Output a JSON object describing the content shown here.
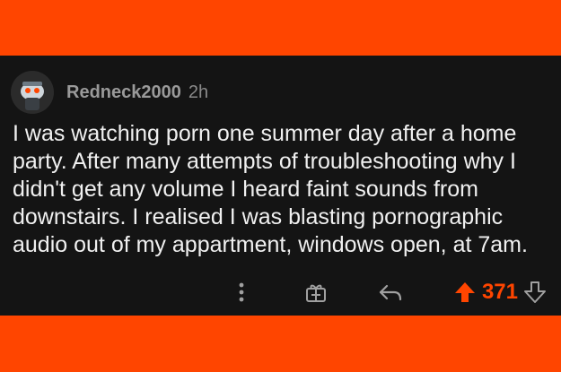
{
  "comment": {
    "username": "Redneck2000",
    "age": "2h",
    "text": "I was watching porn one summer day after a home party. After many attempts of troubleshooting why I didn't get any volume I heard faint sounds from downstairs. I realised I was blasting pornographic audio out of my appartment, windows open, at 7am.",
    "score": "371"
  },
  "colors": {
    "accent": "#ff4500",
    "card_background": "#141414"
  },
  "icons": {
    "more": "more-options-icon",
    "award": "award-icon",
    "reply": "reply-icon",
    "upvote": "upvote-icon",
    "downvote": "downvote-icon"
  }
}
